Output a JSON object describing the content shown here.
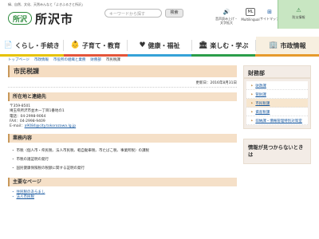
{
  "header": {
    "tagline": "緑、自然、文化、天然みんなと「よきふるさと所沢」",
    "logo_mark": "所沢",
    "city_name": "所沢市",
    "search_placeholder": "キーワードから探す",
    "search_button": "検索",
    "tools": [
      {
        "icon": "🔊",
        "label1": "音声読み上げ・",
        "label2": "文字拡大"
      },
      {
        "icon": "ML",
        "label1": "Multilingual",
        "label2": ""
      },
      {
        "icon": "⊞",
        "label1": "サイトマップ",
        "label2": ""
      },
      {
        "icon": "⚠",
        "label1": "防災情報",
        "label2": ""
      }
    ]
  },
  "nav": [
    {
      "icon": "📄",
      "label": "くらし・手続き"
    },
    {
      "icon": "👶",
      "label": "子育て・教育"
    },
    {
      "icon": "♥",
      "label": "健康・福祉"
    },
    {
      "icon": "🏛",
      "label": "楽しむ・学ぶ"
    },
    {
      "icon": "🏢",
      "label": "市政情報"
    }
  ],
  "breadcrumb": [
    "トップページ",
    "市政情報",
    "市役所の組織と業務",
    "財務部",
    "市民税課"
  ],
  "main": {
    "title": "市民税課",
    "updated": "更新日：2016年8月31日",
    "location_heading": "所在地と連絡先",
    "address_lines": [
      "〒359-8501",
      "埼玉県所沢市並木一丁目1番地の1",
      "電話：04-2998-9064",
      "FAX：04-2998-9409"
    ],
    "email_label": "E-mail：",
    "email": "a9084@city.tokorozawa.lg.jp",
    "duties_heading": "業務内容",
    "duties": [
      "市税（個人市・県民税、法人市民税、軽自動車税、市たばこ税、事業所税）の課税",
      "市税の諸証明の発行",
      "国民健康保険税の税額に関する証明の発行"
    ],
    "main_pages_heading": "主要なページ",
    "main_pages": [
      "住民税のあらまし",
      "法人市民税"
    ]
  },
  "sidebar": {
    "heading": "財務部",
    "items": [
      "財政課",
      "管財課",
      "市民税課",
      "資産税課",
      "収納課・債権管理特別対策室"
    ],
    "current_index": 2,
    "help_text": "情報が見つからないときは"
  }
}
